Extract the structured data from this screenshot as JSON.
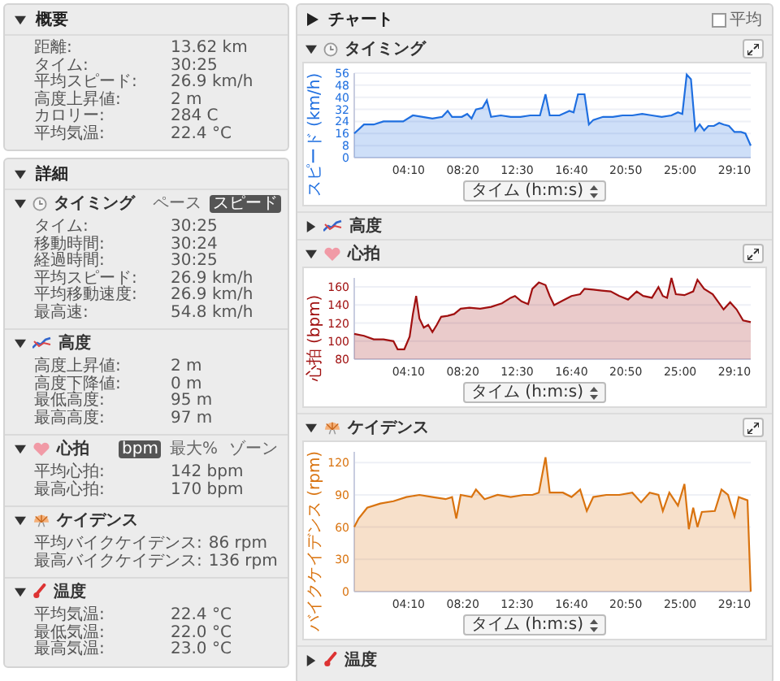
{
  "overview": {
    "title": "概要",
    "expanded": true,
    "rows": [
      {
        "label": "距離:",
        "value": "13.62 km"
      },
      {
        "label": "タイム:",
        "value": "30:25"
      },
      {
        "label": "平均スピード:",
        "value": "26.9 km/h"
      },
      {
        "label": "高度上昇値:",
        "value": "2 m"
      },
      {
        "label": "カロリー:",
        "value": "284 C"
      },
      {
        "label": "平均気温:",
        "value": "22.4 °C"
      }
    ]
  },
  "details": {
    "title": "詳細",
    "expanded": true,
    "sections": [
      {
        "kind": "timing",
        "title": "タイミング",
        "expanded": true,
        "toggles": [
          {
            "label": "ペース",
            "selected": false
          },
          {
            "label": "スピード",
            "selected": true
          }
        ],
        "rows": [
          {
            "label": "タイム:",
            "value": "30:25"
          },
          {
            "label": "移動時間:",
            "value": "30:24"
          },
          {
            "label": "経過時間:",
            "value": "30:25"
          },
          {
            "label": "平均スピード:",
            "value": "26.9 km/h"
          },
          {
            "label": "平均移動速度:",
            "value": "26.9 km/h"
          },
          {
            "label": "最高速:",
            "value": "54.8 km/h"
          }
        ]
      },
      {
        "kind": "elevation",
        "title": "高度",
        "expanded": true,
        "rows": [
          {
            "label": "高度上昇値:",
            "value": "2 m"
          },
          {
            "label": "高度下降値:",
            "value": "0 m"
          },
          {
            "label": "最低高度:",
            "value": "95 m"
          },
          {
            "label": "最高高度:",
            "value": "97 m"
          }
        ]
      },
      {
        "kind": "heart_rate",
        "title": "心拍",
        "expanded": true,
        "toggles": [
          {
            "label": "bpm",
            "selected": true
          },
          {
            "label": "最大%",
            "selected": false
          },
          {
            "label": "ゾーン",
            "selected": false
          }
        ],
        "rows": [
          {
            "label": "平均心拍:",
            "value": "142 bpm"
          },
          {
            "label": "最高心拍:",
            "value": "170 bpm"
          }
        ]
      },
      {
        "kind": "cadence",
        "title": "ケイデンス",
        "expanded": true,
        "rows": [
          {
            "label": "平均バイクケイデンス:",
            "value": "86 rpm"
          },
          {
            "label": "最高バイクケイデンス:",
            "value": "136 rpm"
          }
        ]
      },
      {
        "kind": "temperature",
        "title": "温度",
        "expanded": true,
        "rows": [
          {
            "label": "平均気温:",
            "value": "22.4 °C"
          },
          {
            "label": "最低気温:",
            "value": "22.0 °C"
          },
          {
            "label": "最高気温:",
            "value": "23.0 °C"
          }
        ]
      }
    ]
  },
  "charts": {
    "title": "チャート",
    "average": {
      "label": "平均",
      "checked": false
    },
    "sections": [
      {
        "kind": "timing",
        "title": "タイミング",
        "expanded": true,
        "chart_data": {
          "type": "area",
          "grid": true,
          "ylabel": "スピード (km/h)",
          "xlabel": "タイム (h:m:s)",
          "xlim": [
            0,
            1825
          ],
          "ylim": [
            0,
            56
          ],
          "yticks": [
            0,
            8,
            16,
            24,
            32,
            40,
            48,
            56
          ],
          "xticks": [
            {
              "value": 250,
              "label": "04:10"
            },
            {
              "value": 500,
              "label": "08:20"
            },
            {
              "value": 750,
              "label": "12:30"
            },
            {
              "value": 1000,
              "label": "16:40"
            },
            {
              "value": 1250,
              "label": "20:50"
            },
            {
              "value": 1500,
              "label": "25:00"
            },
            {
              "value": 1750,
              "label": "29:10"
            }
          ],
          "x": [
            0,
            45,
            90,
            135,
            180,
            225,
            270,
            315,
            360,
            405,
            430,
            450,
            495,
            520,
            540,
            560,
            590,
            610,
            630,
            675,
            720,
            765,
            810,
            855,
            880,
            900,
            945,
            990,
            1010,
            1030,
            1060,
            1080,
            1100,
            1145,
            1190,
            1235,
            1280,
            1325,
            1370,
            1415,
            1460,
            1490,
            1510,
            1530,
            1550,
            1570,
            1590,
            1610,
            1630,
            1655,
            1680,
            1700,
            1725,
            1750,
            1780,
            1800,
            1825
          ],
          "series": [
            {
              "color": "#1f6fe0",
              "values": [
                16,
                22,
                22,
                24,
                24,
                24,
                28,
                27,
                26,
                27,
                31,
                27,
                27,
                29,
                26,
                32,
                33,
                38,
                27,
                28,
                27,
                27,
                28,
                28,
                42,
                28,
                28,
                31,
                30,
                42,
                42,
                22,
                25,
                27,
                27,
                28,
                28,
                29,
                28,
                27,
                28,
                30,
                29,
                55,
                52,
                18,
                22,
                18,
                21,
                21,
                23,
                22,
                21,
                17,
                17,
                16,
                8
              ]
            }
          ]
        }
      },
      {
        "kind": "elevation",
        "title": "高度",
        "expanded": false
      },
      {
        "kind": "heart_rate",
        "title": "心拍",
        "expanded": true,
        "chart_data": {
          "type": "area",
          "grid": true,
          "ylabel": "心拍 (bpm)",
          "xlabel": "タイム (h:m:s)",
          "xlim": [
            0,
            1825
          ],
          "ylim": [
            80,
            170
          ],
          "yticks": [
            80,
            100,
            120,
            140,
            160
          ],
          "xticks": [
            {
              "value": 250,
              "label": "04:10"
            },
            {
              "value": 500,
              "label": "08:20"
            },
            {
              "value": 750,
              "label": "12:30"
            },
            {
              "value": 1000,
              "label": "16:40"
            },
            {
              "value": 1250,
              "label": "20:50"
            },
            {
              "value": 1500,
              "label": "25:00"
            },
            {
              "value": 1750,
              "label": "29:10"
            }
          ],
          "x": [
            0,
            45,
            90,
            135,
            180,
            200,
            230,
            255,
            270,
            285,
            300,
            320,
            340,
            360,
            380,
            400,
            430,
            460,
            490,
            530,
            580,
            630,
            680,
            720,
            740,
            770,
            800,
            820,
            850,
            880,
            900,
            920,
            960,
            1000,
            1040,
            1060,
            1100,
            1140,
            1180,
            1220,
            1260,
            1300,
            1330,
            1370,
            1400,
            1420,
            1440,
            1460,
            1480,
            1520,
            1560,
            1580,
            1610,
            1650,
            1700,
            1730,
            1760,
            1790,
            1825
          ],
          "series": [
            {
              "color": "#a01010",
              "values": [
                108,
                106,
                102,
                102,
                100,
                91,
                91,
                105,
                130,
                150,
                125,
                115,
                118,
                110,
                118,
                127,
                128,
                130,
                136,
                137,
                136,
                138,
                142,
                148,
                150,
                144,
                141,
                158,
                165,
                162,
                150,
                140,
                145,
                150,
                152,
                158,
                157,
                156,
                155,
                150,
                146,
                155,
                150,
                148,
                160,
                150,
                148,
                170,
                152,
                151,
                155,
                168,
                158,
                152,
                135,
                143,
                135,
                123,
                121
              ]
            }
          ]
        }
      },
      {
        "kind": "cadence",
        "title": "ケイデンス",
        "expanded": true,
        "chart_data": {
          "type": "area",
          "grid": true,
          "ylabel": "バイクケイデンス (rpm)",
          "xlabel": "タイム (h:m:s)",
          "xlim": [
            0,
            1825
          ],
          "ylim": [
            0,
            130
          ],
          "yticks": [
            0,
            30,
            60,
            90,
            120
          ],
          "xticks": [
            {
              "value": 250,
              "label": "04:10"
            },
            {
              "value": 500,
              "label": "08:20"
            },
            {
              "value": 750,
              "label": "12:30"
            },
            {
              "value": 1000,
              "label": "16:40"
            },
            {
              "value": 1250,
              "label": "20:50"
            },
            {
              "value": 1500,
              "label": "25:00"
            },
            {
              "value": 1750,
              "label": "29:10"
            }
          ],
          "x": [
            0,
            20,
            60,
            120,
            180,
            240,
            300,
            360,
            420,
            450,
            470,
            490,
            540,
            560,
            600,
            660,
            720,
            780,
            820,
            850,
            880,
            900,
            960,
            1000,
            1040,
            1070,
            1100,
            1160,
            1220,
            1280,
            1320,
            1360,
            1400,
            1420,
            1450,
            1490,
            1520,
            1540,
            1560,
            1580,
            1600,
            1660,
            1690,
            1720,
            1750,
            1770,
            1810,
            1825
          ],
          "series": [
            {
              "color": "#d9730f",
              "values": [
                60,
                68,
                78,
                82,
                84,
                88,
                90,
                88,
                86,
                88,
                68,
                90,
                88,
                95,
                86,
                90,
                88,
                90,
                90,
                92,
                125,
                92,
                92,
                88,
                95,
                75,
                88,
                90,
                90,
                92,
                83,
                92,
                90,
                75,
                92,
                80,
                100,
                58,
                78,
                60,
                74,
                75,
                95,
                90,
                70,
                88,
                85,
                0
              ]
            }
          ]
        }
      },
      {
        "kind": "temperature",
        "title": "温度",
        "expanded": false
      }
    ]
  }
}
